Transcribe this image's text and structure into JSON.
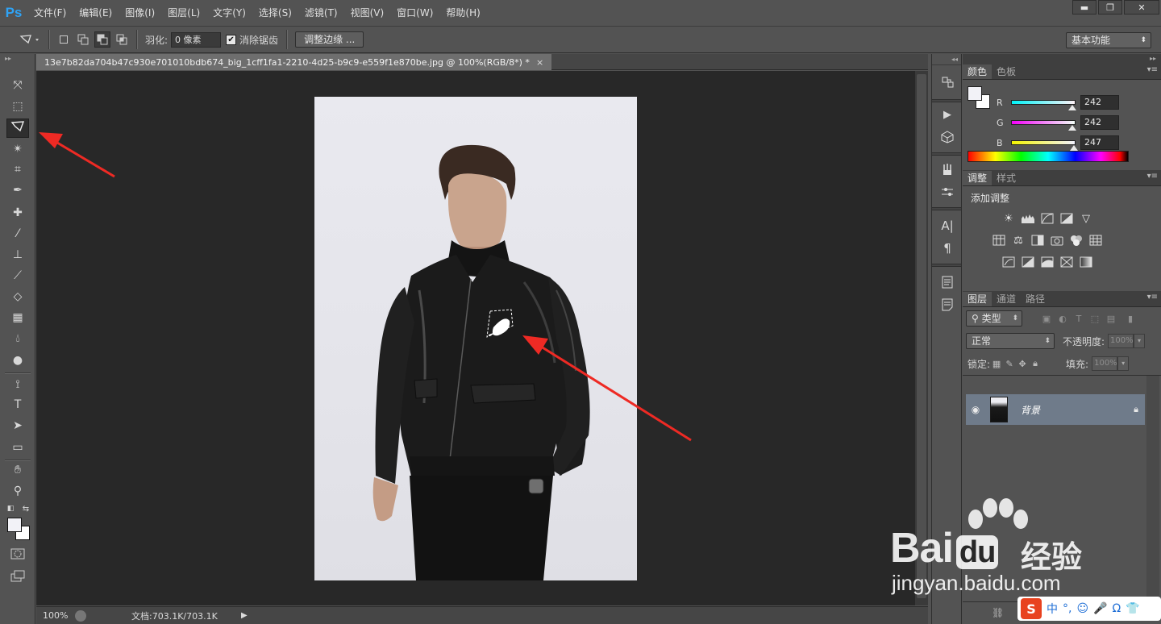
{
  "app": {
    "logo": "Ps"
  },
  "menu": [
    "文件(F)",
    "编辑(E)",
    "图像(I)",
    "图层(L)",
    "文字(Y)",
    "选择(S)",
    "滤镜(T)",
    "视图(V)",
    "窗口(W)",
    "帮助(H)"
  ],
  "window_controls": {
    "minimize": "▬",
    "restore": "❐",
    "close": "✕"
  },
  "options": {
    "feather_label": "羽化:",
    "feather_value": "0 像素",
    "antialias_label": "消除锯齿",
    "antialias_checked": "✔",
    "refine_edge_label": "调整边缘 ...",
    "workspace": "基本功能"
  },
  "document": {
    "tab_title": "13e7b82da704b47c930e701010bdb674_big_1cff1fa1-2210-4d25-b9c9-e559f1e870be.jpg @ 100%(RGB/8*) *",
    "tab_close": "×",
    "zoom": "100%",
    "doc_info": "文档:703.1K/703.1K"
  },
  "tools": [
    "move-tool",
    "marquee-tool",
    "polygonal-lasso-tool",
    "magic-wand-tool",
    "crop-tool",
    "eyedropper-tool",
    "healing-brush-tool",
    "brush-tool",
    "clone-stamp-tool",
    "history-brush-tool",
    "eraser-tool",
    "gradient-tool",
    "blur-tool",
    "dodge-tool",
    "pen-tool",
    "type-tool",
    "path-selection-tool",
    "shape-tool",
    "hand-tool",
    "zoom-tool"
  ],
  "tool_glyphs": {
    "type-tool": "T"
  },
  "color_panel": {
    "tabs": [
      "颜色",
      "色板"
    ],
    "r_label": "R",
    "g_label": "G",
    "b_label": "B",
    "r": "242",
    "g": "242",
    "b": "247",
    "foreground": "#f2f2f7",
    "background": "#ffffff"
  },
  "adjustments_panel": {
    "tabs": [
      "调整",
      "样式"
    ],
    "title": "添加调整"
  },
  "layers_panel": {
    "tabs": [
      "图层",
      "通道",
      "路径"
    ],
    "filter_kind": "类型",
    "blend_mode": "正常",
    "opacity_label": "不透明度:",
    "opacity_value": "100%",
    "lock_label": "锁定:",
    "fill_label": "填充:",
    "fill_value": "100%",
    "layers": [
      {
        "name": "背景"
      }
    ]
  },
  "watermark": {
    "brand": "Bai",
    "brand_du": "du",
    "jingyan": "经验",
    "url": "jingyan.baidu.com"
  },
  "ime": {
    "logo": "S",
    "lang": "中",
    "punct": "°,",
    "emoji": "☺",
    "mic": "🎤",
    "omega": "Ω",
    "shirt": "👕"
  },
  "colors": {
    "accent_ps": "#2fa3f5",
    "annotation_red": "#ee2a24",
    "layer_selected": "#6f7b8a"
  }
}
